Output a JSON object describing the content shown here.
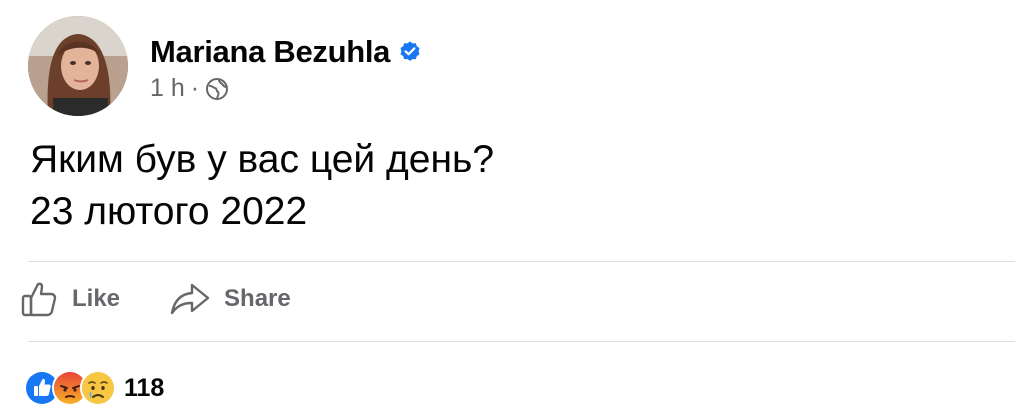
{
  "post": {
    "author": {
      "name": "Mariana Bezuhla",
      "verified_icon": "verified-badge-icon",
      "avatar_icon": "avatar-photo"
    },
    "meta": {
      "time": "1 h",
      "separator": "·",
      "audience_icon": "globe-icon"
    },
    "text_lines": [
      "Яким був у вас цей день?",
      "23 лютого 2022"
    ],
    "actions": {
      "like_label": "Like",
      "share_label": "Share"
    },
    "reactions": {
      "icons": [
        "like-reaction-icon",
        "angry-reaction-icon",
        "sad-reaction-icon"
      ],
      "count": "118"
    },
    "colors": {
      "secondary_text": "#65676b",
      "divider": "#dadde1",
      "facebook_blue": "#1877f2",
      "primary_text": "#050505"
    }
  }
}
